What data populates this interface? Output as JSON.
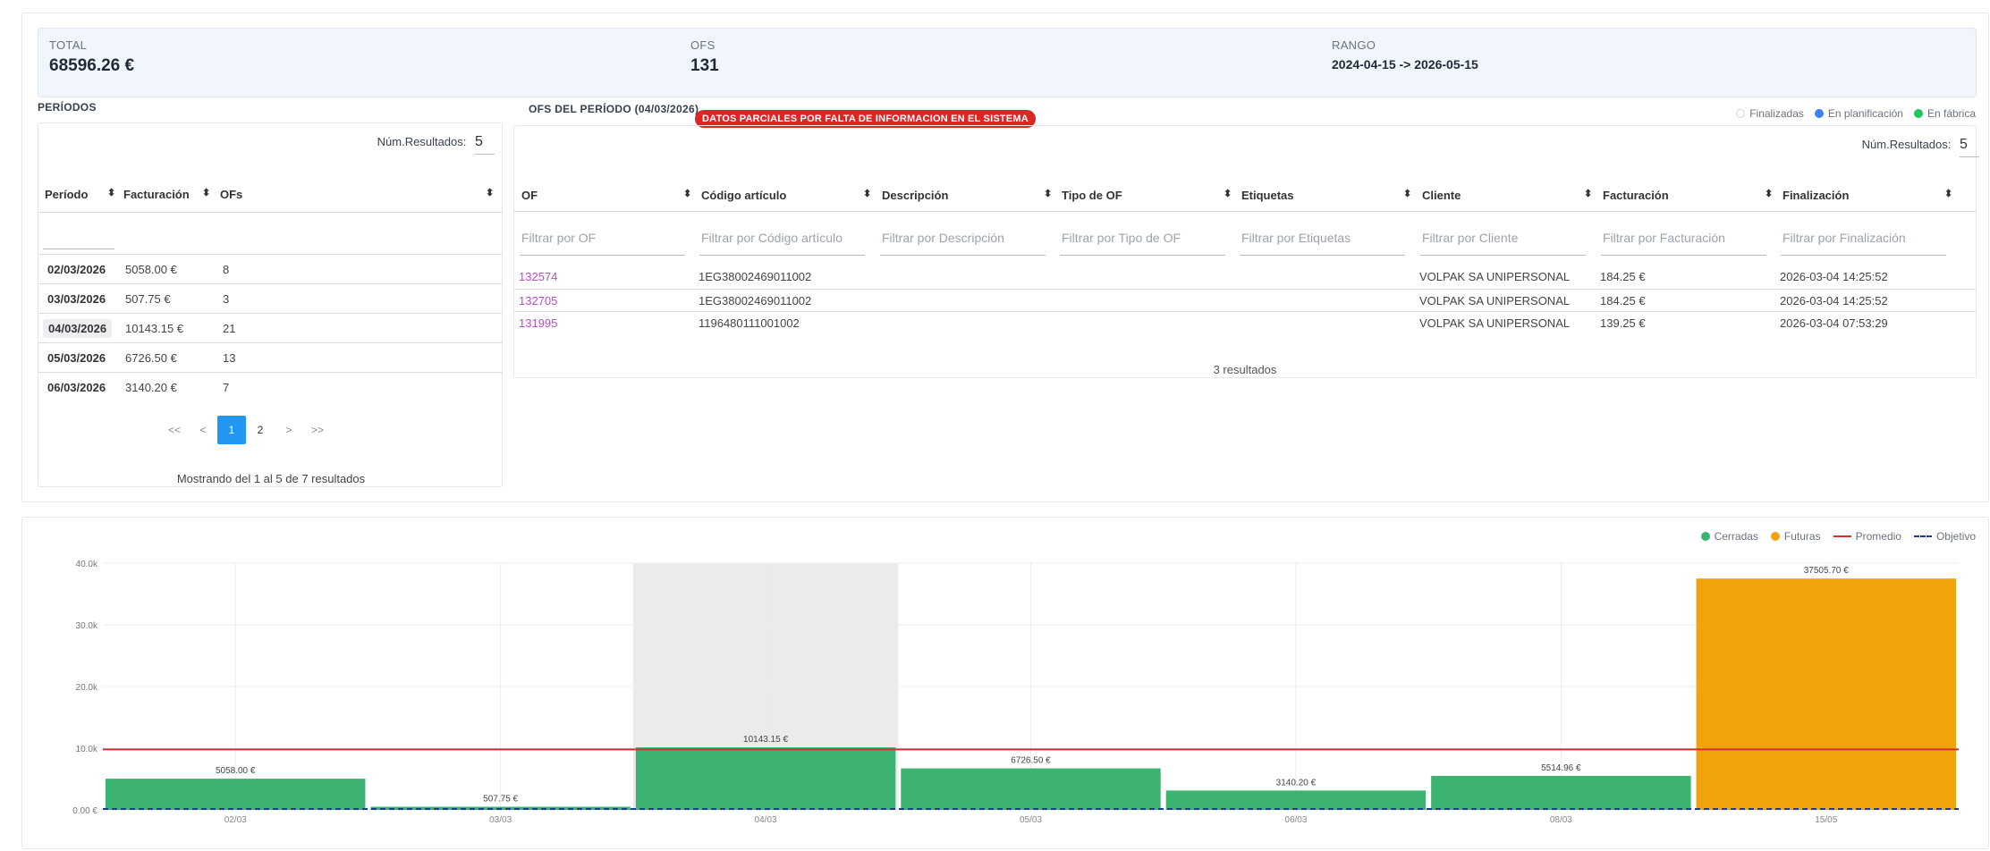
{
  "summary": {
    "total_label": "TOTAL",
    "total_value": "68596.26 €",
    "ofs_label": "OFS",
    "ofs_value": "131",
    "range_label": "RANGO",
    "range_value": "2024-04-15 -> 2026-05-15"
  },
  "periods": {
    "title": "PERÍODOS",
    "num_results_label": "Núm.Resultados:",
    "num_results_value": "5",
    "columns": [
      "Período",
      "Facturación",
      "OFs"
    ],
    "rows": [
      {
        "period": "02/03/2026",
        "billing": "5058.00 €",
        "ofs": "8",
        "selected": false
      },
      {
        "period": "03/03/2026",
        "billing": "507.75 €",
        "ofs": "3",
        "selected": false
      },
      {
        "period": "04/03/2026",
        "billing": "10143.15 €",
        "ofs": "21",
        "selected": true
      },
      {
        "period": "05/03/2026",
        "billing": "6726.50 €",
        "ofs": "13",
        "selected": false
      },
      {
        "period": "06/03/2026",
        "billing": "3140.20 €",
        "ofs": "7",
        "selected": false
      }
    ],
    "pager": {
      "first": "<<",
      "prev": "<",
      "pages": [
        "1",
        "2"
      ],
      "active_page": "1",
      "next": ">",
      "last": ">>"
    },
    "pager_info": "Mostrando del 1 al 5 de 7 resultados"
  },
  "ofs": {
    "title": "OFS DEL PERÍODO (04/03/2026)",
    "badge": "DATOS PARCIALES POR FALTA DE INFORMACION EN EL SISTEMA",
    "legend": [
      {
        "label": "Finalizadas",
        "color": "#ffffff"
      },
      {
        "label": "En planificación",
        "color": "#3b82f6"
      },
      {
        "label": "En fábrica",
        "color": "#22c55e"
      }
    ],
    "num_results_label": "Núm.Resultados:",
    "num_results_value": "5",
    "columns": [
      "OF",
      "Código artículo",
      "Descripción",
      "Tipo de OF",
      "Etiquetas",
      "Cliente",
      "Facturación",
      "Finalización"
    ],
    "filters": [
      "Filtrar por OF",
      "Filtrar por Código artículo",
      "Filtrar por Descripción",
      "Filtrar por Tipo de OF",
      "Filtrar por Etiquetas",
      "Filtrar por Cliente",
      "Filtrar por Facturación",
      "Filtrar por Finalización"
    ],
    "rows": [
      {
        "of": "132574",
        "code": "1EG38002469011002",
        "desc": "",
        "type": "",
        "tags": "",
        "client": "VOLPAK SA UNIPERSONAL",
        "billing": "184.25 €",
        "end": "2026-03-04 14:25:52"
      },
      {
        "of": "132705",
        "code": "1EG38002469011002",
        "desc": "",
        "type": "",
        "tags": "",
        "client": "VOLPAK SA UNIPERSONAL",
        "billing": "184.25 €",
        "end": "2026-03-04 14:25:52"
      },
      {
        "of": "131995",
        "code": "1196480111001002",
        "desc": "",
        "type": "",
        "tags": "",
        "client": "VOLPAK SA UNIPERSONAL",
        "billing": "139.25 €",
        "end": "2026-03-04 07:53:29"
      }
    ],
    "count_text": "3 resultados"
  },
  "chart_legend": [
    {
      "label": "Cerradas",
      "kind": "dot",
      "color": "#3cb371"
    },
    {
      "label": "Futuras",
      "kind": "dot",
      "color": "#f0a30a"
    },
    {
      "label": "Promedio",
      "kind": "line",
      "color": "#d32f2f"
    },
    {
      "label": "Objetivo",
      "kind": "dash",
      "color": "#1e3a8a"
    }
  ],
  "chart_data": {
    "type": "bar",
    "categories": [
      "02/03",
      "03/03",
      "04/03",
      "05/03",
      "06/03",
      "08/03",
      "15/05"
    ],
    "series": [
      {
        "name": "Cerradas",
        "color": "#3cb371",
        "values": [
          5058.0,
          507.75,
          10143.15,
          6726.5,
          3140.2,
          5514.96,
          null
        ]
      },
      {
        "name": "Futuras",
        "color": "#f0a30a",
        "values": [
          null,
          null,
          null,
          null,
          null,
          null,
          37505.7
        ]
      }
    ],
    "data_labels": [
      "5058.00 €",
      "507.75 €",
      "10143.15 €",
      "6726.50 €",
      "3140.20 €",
      "5514.96 €",
      "37505.70 €"
    ],
    "promedio": 9799.47,
    "objetivo": 0,
    "highlighted_category": "04/03",
    "y_ticks": [
      {
        "v": 0,
        "label": "0.00 €"
      },
      {
        "v": 10000,
        "label": "10.0k"
      },
      {
        "v": 20000,
        "label": "20.0k"
      },
      {
        "v": 30000,
        "label": "30.0k"
      },
      {
        "v": 40000,
        "label": "40.0k"
      }
    ],
    "ylim": [
      0,
      40000
    ],
    "grid": true,
    "legend_position": "top-right"
  }
}
